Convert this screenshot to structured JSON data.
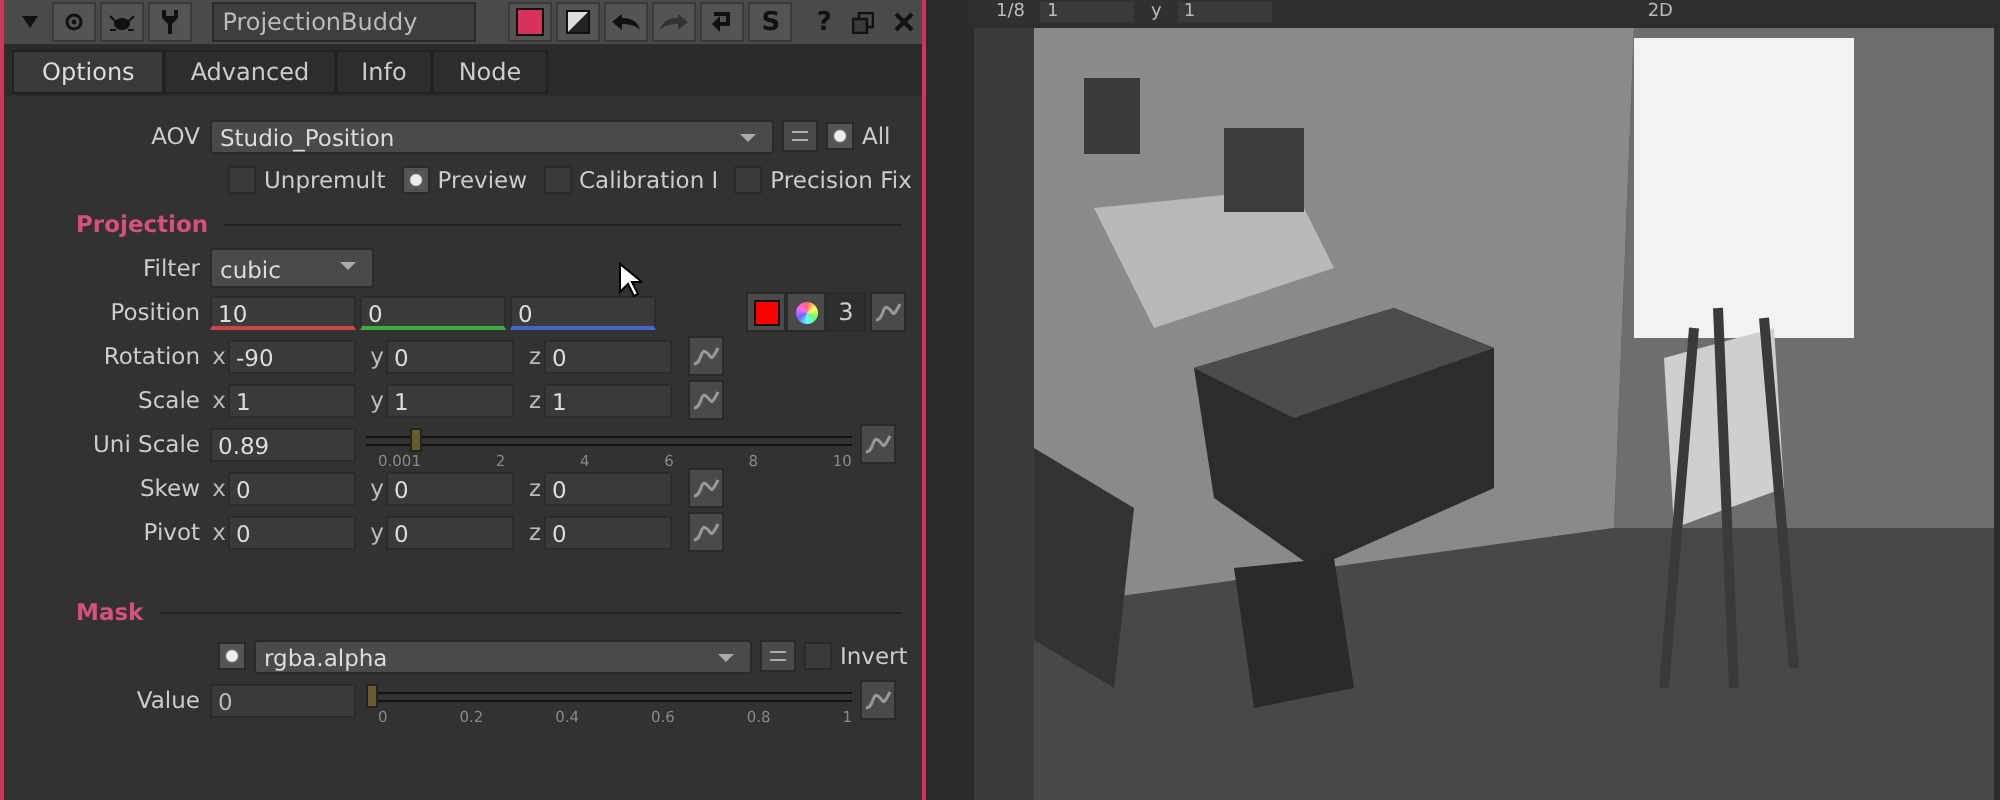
{
  "panel": {
    "name": "ProjectionBuddy",
    "snap_glyph": "S",
    "help_glyph": "?"
  },
  "tabs": [
    {
      "label": "Options",
      "selected": true
    },
    {
      "label": "Advanced",
      "selected": false
    },
    {
      "label": "Info",
      "selected": false
    },
    {
      "label": "Node",
      "selected": false
    }
  ],
  "aov": {
    "label": "AOV",
    "value": "Studio_Position",
    "all": {
      "label": "All",
      "checked": true
    }
  },
  "options": [
    {
      "label": "Unpremult",
      "checked": false
    },
    {
      "label": "Preview",
      "checked": true
    },
    {
      "label": "Calibration I",
      "checked": false
    },
    {
      "label": "Precision Fix",
      "checked": false
    }
  ],
  "projection": {
    "heading": "Projection",
    "knobs": [
      {
        "kind": "dropdown",
        "label": "Filter",
        "value": "cubic"
      },
      {
        "kind": "color_xyz",
        "label": "Position",
        "values": [
          "10",
          "0",
          "0"
        ],
        "channels": "3"
      },
      {
        "kind": "xyz",
        "label": "Rotation",
        "axes": [
          "x",
          "y",
          "z"
        ],
        "values": [
          "-90",
          "0",
          "0"
        ]
      },
      {
        "kind": "xyz",
        "label": "Scale",
        "axes": [
          "x",
          "y",
          "z"
        ],
        "values": [
          "1",
          "1",
          "1"
        ]
      },
      {
        "kind": "slider",
        "label": "Uni Scale",
        "value": "0.89",
        "level": 0.089,
        "ticks": [
          "0.001",
          "2",
          "4",
          "6",
          "8",
          "10"
        ]
      },
      {
        "kind": "xyz",
        "label": "Skew",
        "axes": [
          "x",
          "y",
          "z"
        ],
        "values": [
          "0",
          "0",
          "0"
        ]
      },
      {
        "kind": "xyz",
        "label": "Pivot",
        "axes": [
          "x",
          "y",
          "z"
        ],
        "values": [
          "0",
          "0",
          "0"
        ]
      }
    ]
  },
  "mask": {
    "heading": "Mask",
    "enabled": true,
    "channel": "rgba.alpha",
    "invert": {
      "label": "Invert",
      "checked": false
    },
    "value": {
      "label": "Value",
      "value": "0",
      "level": 0,
      "ticks": [
        "0",
        "0.2",
        "0.4",
        "0.6",
        "0.8",
        "1"
      ]
    }
  },
  "viewer": {
    "frame": "1/8",
    "gain": "1",
    "gamma_label": "y",
    "gamma": "1",
    "mode": "2D"
  }
}
